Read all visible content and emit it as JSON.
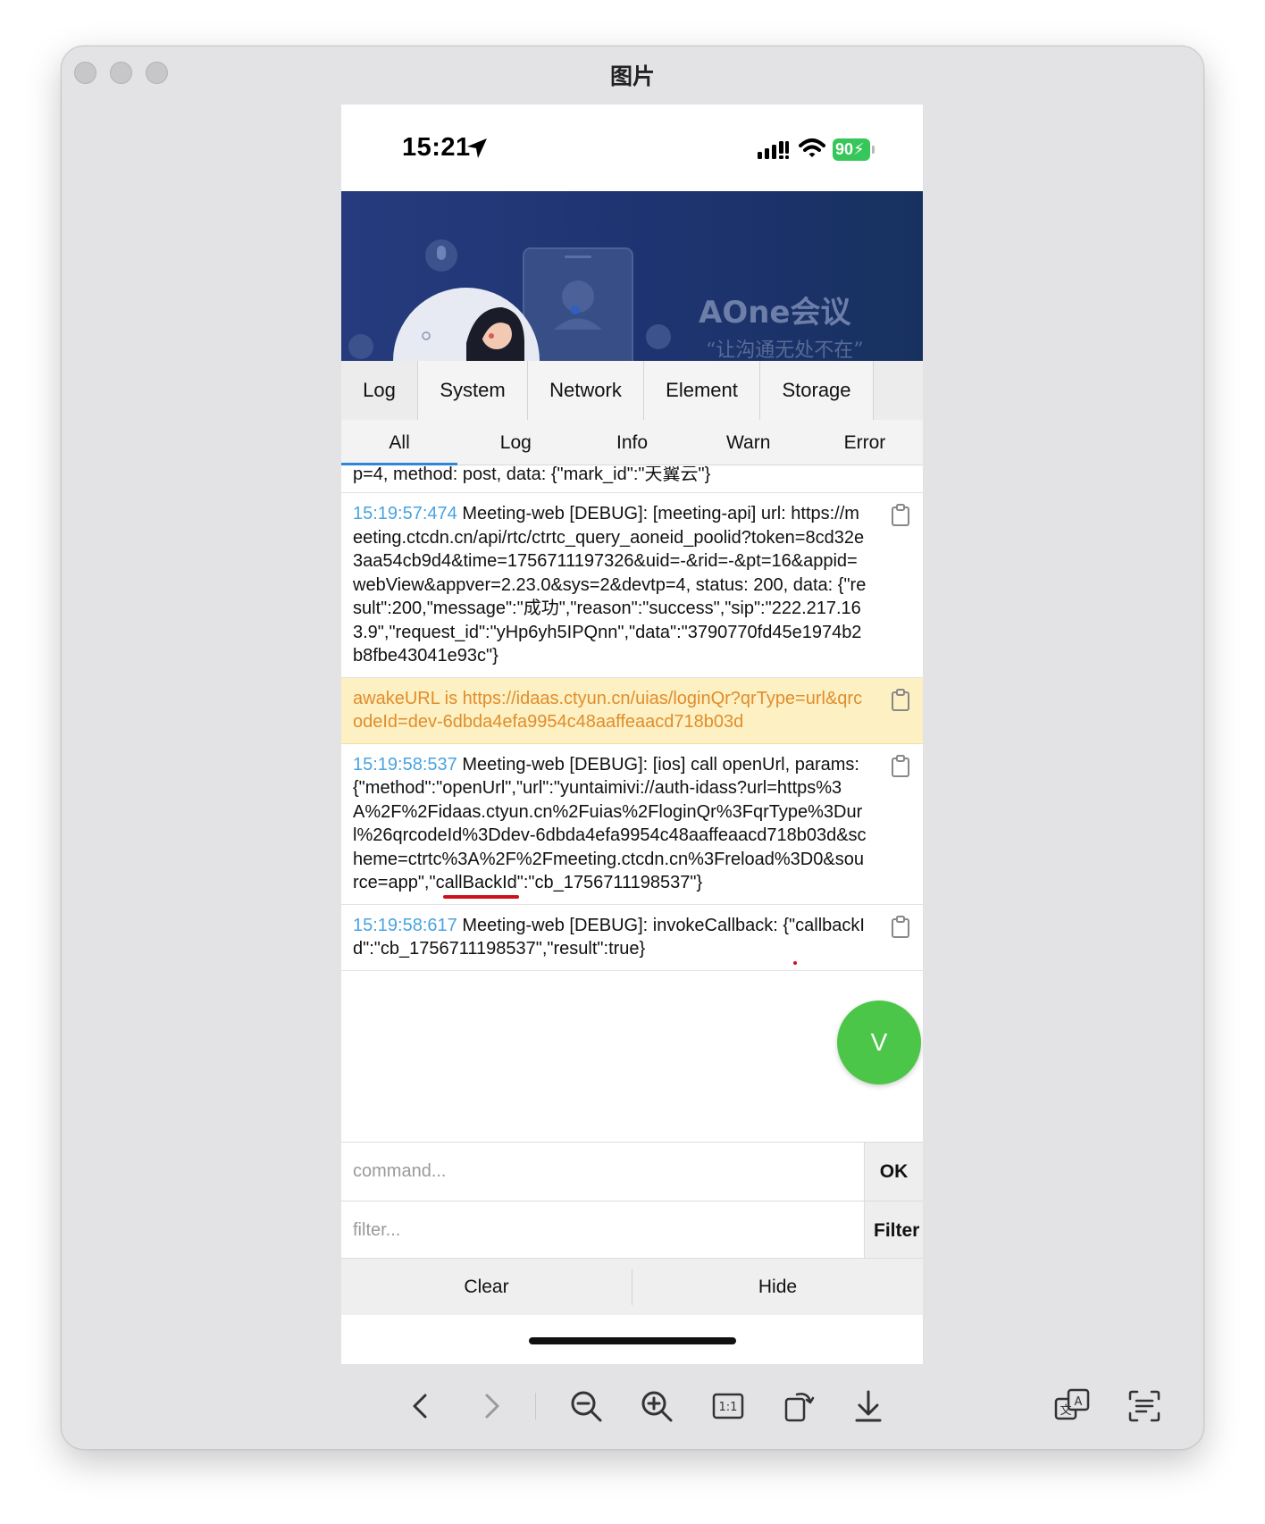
{
  "window": {
    "title": "图片"
  },
  "status_bar": {
    "time": "15:21",
    "battery": "90"
  },
  "banner": {
    "title": "AOne会议",
    "subtitle": "“让沟通无处不在”"
  },
  "tabs": [
    {
      "label": "Log",
      "active": true
    },
    {
      "label": "System",
      "active": false
    },
    {
      "label": "Network",
      "active": false
    },
    {
      "label": "Element",
      "active": false
    },
    {
      "label": "Storage",
      "active": false
    }
  ],
  "subtabs": [
    {
      "label": "All",
      "active": true
    },
    {
      "label": "Log",
      "active": false
    },
    {
      "label": "Info",
      "active": false
    },
    {
      "label": "Warn",
      "active": false
    },
    {
      "label": "Error",
      "active": false
    }
  ],
  "logs": {
    "truncated": "p=4, method: post, data: {\"mark_id\":\"天翼云\"}",
    "entry1": {
      "time": "15:19:57:474",
      "text": " Meeting-web [DEBUG]: [meeting-api] url: https://meeting.ctcdn.cn/api/rtc/ctrtc_query_aoneid_poolid?token=8cd32e3aa54cb9d4&time=1756711197326&uid=-&rid=-&pt=16&appid=webView&appver=2.23.0&sys=2&devtp=4, status: 200, data: {\"result\":200,\"message\":\"成功\",\"reason\":\"success\",\"sip\":\"222.217.163.9\",\"request_id\":\"yHp6yh5IPQnn\",\"data\":\"3790770fd45e1974b2b8fbe43041e93c\"}"
    },
    "entry2": {
      "text": "awakeURL is  https://idaas.ctyun.cn/uias/loginQr?qrType=url&qrcodeId=dev-6dbda4efa9954c48aaffeaacd718b03d"
    },
    "entry3": {
      "time": "15:19:58:537",
      "text_a": " Meeting-web [DEBUG]: [ios] call openUrl, params: {\"method\":\"openUrl\",\"url\":\"yuntaimivi://auth-idass?url=https%3A%2F%2Fidaas.ctyun.cn%2Fuias%2FloginQr%3FqrType%3Durl%26qrcodeId%3Ddev-6dbda4efa9954c48aaffeaacd718b03d&scheme=ctrtc%3A%2F%2Fmeeting.ctcdn.cn%3Freload%3D0&source=app\",\"c",
      "underlined": "allBackId",
      "text_b": "\":\"cb_1756711198537\"}"
    },
    "entry4": {
      "time": "15:19:58:617",
      "text_a": " Meeting-web [DEBUG]: invokeCallback: {\"",
      "underlined": "callbackId",
      "text_b": "\":\"cb_1756711198537\",\"result\":true}"
    }
  },
  "floating_button": "V",
  "command": {
    "placeholder": "command...",
    "button": "OK"
  },
  "filter": {
    "placeholder": "filter...",
    "button": "Filter"
  },
  "bottom": {
    "clear": "Clear",
    "hide": "Hide"
  },
  "colors": {
    "timestamp": "#49a3e0",
    "warn_bg": "#fdf0c2",
    "warn_text": "#e08d2c",
    "underline": "#d00f1c",
    "fab": "#4cc648"
  },
  "toolbar_icons": [
    "chevron-left-icon",
    "chevron-right-icon",
    "zoom-out-icon",
    "zoom-in-icon",
    "actual-size-icon",
    "rotate-icon",
    "download-icon",
    "translate-icon",
    "text-recognition-icon"
  ]
}
